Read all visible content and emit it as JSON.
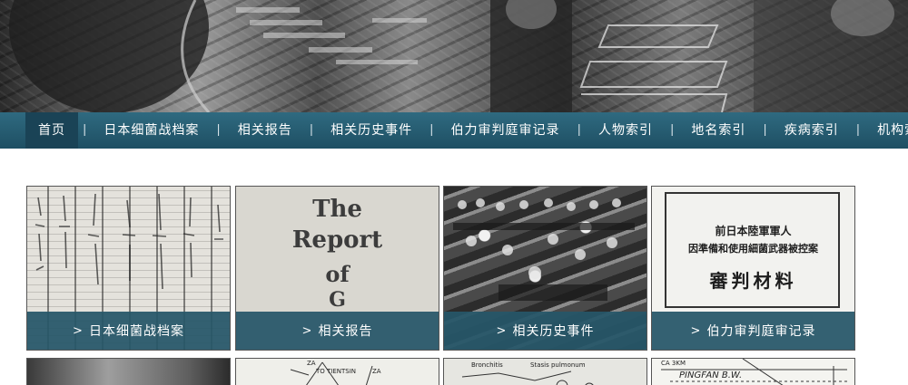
{
  "nav": {
    "items": [
      {
        "label": "首页",
        "active": true
      },
      {
        "label": "日本细菌战档案"
      },
      {
        "label": "相关报告"
      },
      {
        "label": "相关历史事件"
      },
      {
        "label": "伯力审判庭审记录"
      },
      {
        "label": "人物索引"
      },
      {
        "label": "地名索引"
      },
      {
        "label": "疾病索引"
      },
      {
        "label": "机构索引"
      }
    ],
    "separator": "|"
  },
  "cards": [
    {
      "caption": "日本细菌战档案",
      "chevron": ">"
    },
    {
      "caption": "相关报告",
      "chevron": ">",
      "thumb_text": [
        "The",
        "Report",
        "of",
        "G"
      ]
    },
    {
      "caption": "相关历史事件",
      "chevron": ">"
    },
    {
      "caption": "伯力审判庭审记录",
      "chevron": ">",
      "thumb_text": [
        "前日本陸軍軍人",
        "因準備和使用細菌武器被控案",
        "審判材料"
      ]
    }
  ],
  "row2": {
    "map_labels": [
      "ZA",
      "TO TIENTSIN",
      "ZA"
    ],
    "diagram_labels": [
      "Bronchitis",
      "Stasis pulmonum"
    ],
    "plan_labels": [
      "PINGFAN B.W.",
      "CA 3KM"
    ]
  },
  "colors": {
    "nav_bg": "#1e4f63",
    "caption_bg": "#265668"
  }
}
